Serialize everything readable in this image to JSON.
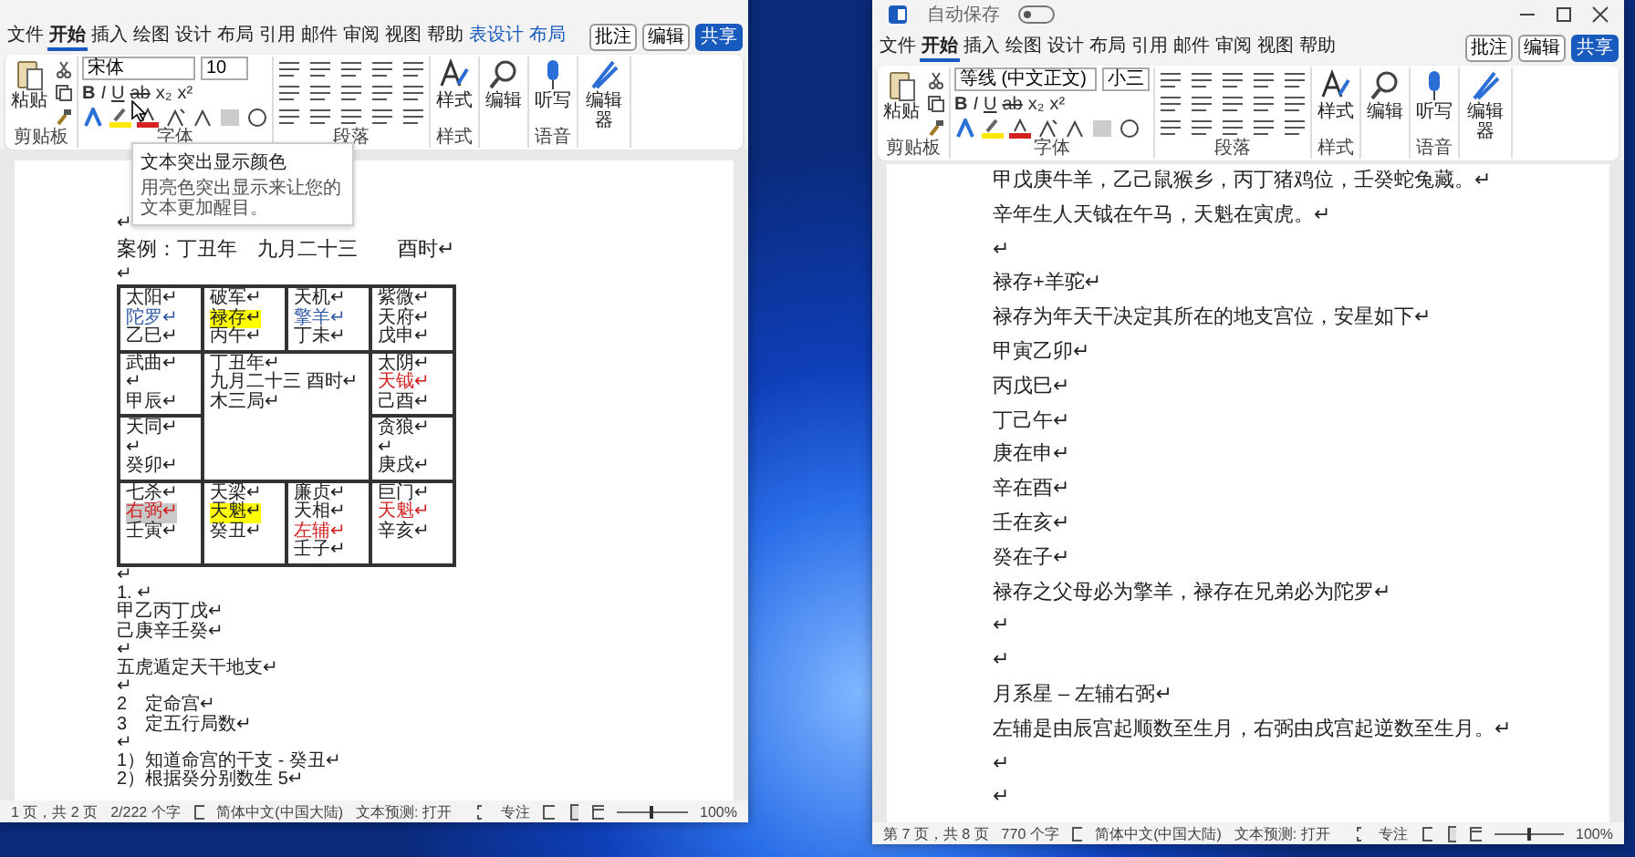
{
  "windows": [
    {
      "tabs": [
        {
          "label": "文件",
          "selected": false,
          "kind": "normal"
        },
        {
          "label": "开始",
          "selected": true,
          "kind": "normal"
        },
        {
          "label": "插入",
          "selected": false,
          "kind": "normal"
        },
        {
          "label": "绘图",
          "selected": false,
          "kind": "normal"
        },
        {
          "label": "设计",
          "selected": false,
          "kind": "normal"
        },
        {
          "label": "布局",
          "selected": false,
          "kind": "normal"
        },
        {
          "label": "引用",
          "selected": false,
          "kind": "normal"
        },
        {
          "label": "邮件",
          "selected": false,
          "kind": "normal"
        },
        {
          "label": "审阅",
          "selected": false,
          "kind": "normal"
        },
        {
          "label": "视图",
          "selected": false,
          "kind": "normal"
        },
        {
          "label": "帮助",
          "selected": false,
          "kind": "normal"
        },
        {
          "label": "表设计",
          "selected": false,
          "kind": "contextual"
        },
        {
          "label": "布局",
          "selected": false,
          "kind": "contextual"
        }
      ],
      "actions": [
        {
          "label": "批注",
          "kind": "outline"
        },
        {
          "label": "编辑",
          "kind": "outline"
        },
        {
          "label": "共享",
          "kind": "primary"
        }
      ],
      "sections": [
        {
          "kind": "clipboard",
          "label": "剪贴板",
          "button": "粘贴"
        },
        {
          "kind": "font",
          "label": "字体",
          "font_name": "宋体",
          "font_size": "10",
          "format_buttons": [
            "B",
            "I",
            "U",
            "ab",
            "x₂",
            "x²"
          ]
        },
        {
          "kind": "paragraph",
          "label": "段落"
        },
        {
          "kind": "styles",
          "label": "样式",
          "button": "样式"
        },
        {
          "kind": "editing",
          "button": "编辑"
        },
        {
          "kind": "dictate",
          "label": "语音",
          "button": "听写"
        },
        {
          "kind": "editor",
          "button": "编辑器"
        }
      ],
      "tooltip": {
        "title": "文本突出显示颜色",
        "body": "用亮色突出显示来让您的文本更加醒目。"
      },
      "doc": [
        {
          "kind": "para",
          "text": "↵"
        },
        {
          "kind": "title",
          "text": "案例：丁丑年　九月二十三　　酉时↵"
        },
        {
          "kind": "para",
          "text": "↵"
        },
        {
          "kind": "table",
          "cells": [
            {
              "kind": "palace",
              "lines": [
                {
                  "text": "太阳↵",
                  "color": "#222222"
                },
                {
                  "text": "陀罗↵",
                  "color": "#2f5aa8"
                },
                {
                  "text": "乙巳↵",
                  "color": "#222222"
                }
              ]
            },
            {
              "kind": "palace",
              "lines": [
                {
                  "text": "破军↵",
                  "color": "#222222"
                },
                {
                  "text": "禄存↵",
                  "highlight": {
                    "color": "#ffff00"
                  }
                },
                {
                  "text": "丙午↵",
                  "color": "#222222"
                }
              ]
            },
            {
              "kind": "palace",
              "lines": [
                {
                  "text": "天机↵",
                  "color": "#222222"
                },
                {
                  "text": "擎羊↵",
                  "color": "#2f5aa8"
                },
                {
                  "text": "丁未↵",
                  "color": "#222222"
                }
              ]
            },
            {
              "kind": "palace",
              "lines": [
                {
                  "text": "紫微↵",
                  "color": "#222222"
                },
                {
                  "text": "天府↵",
                  "color": "#222222"
                },
                {
                  "text": "戊申↵",
                  "color": "#222222"
                }
              ]
            },
            {
              "kind": "palace",
              "lines": [
                {
                  "text": "武曲↵",
                  "color": "#222222"
                },
                {
                  "text": "↵",
                  "color": "#222222"
                },
                {
                  "text": "甲辰↵",
                  "color": "#222222"
                }
              ]
            },
            {
              "kind": "center",
              "lines": [
                {
                  "text": "丁丑年↵",
                  "color": "#222222"
                },
                {
                  "text": "九月二十三 酉时↵",
                  "color": "#222222"
                },
                {
                  "text": "木三局↵",
                  "color": "#222222"
                }
              ]
            },
            {
              "kind": "palace",
              "lines": [
                {
                  "text": "太阴↵",
                  "color": "#222222"
                },
                {
                  "text": "天钺↵",
                  "color": "#d42020"
                },
                {
                  "text": "己酉↵",
                  "color": "#222222"
                }
              ]
            },
            {
              "kind": "palace",
              "lines": [
                {
                  "text": "天同↵",
                  "color": "#222222"
                },
                {
                  "text": "↵",
                  "color": "#222222"
                },
                {
                  "text": "癸卯↵",
                  "color": "#222222"
                }
              ]
            },
            {
              "kind": "palace",
              "lines": [
                {
                  "text": "贪狼↵",
                  "color": "#222222"
                },
                {
                  "text": "↵",
                  "color": "#222222"
                },
                {
                  "text": "庚戌↵",
                  "color": "#222222"
                }
              ]
            },
            {
              "kind": "palace",
              "lines": [
                {
                  "text": "七杀↵",
                  "color": "#222222"
                },
                {
                  "text": "右弼↵",
                  "color": "#d42020",
                  "highlight": {
                    "color": "#c8c8c8"
                  }
                },
                {
                  "text": "壬寅↵",
                  "color": "#222222"
                }
              ]
            },
            {
              "kind": "palace",
              "lines": [
                {
                  "text": "天梁↵",
                  "color": "#222222"
                },
                {
                  "text": "天魁↵",
                  "highlight": {
                    "color": "#ffff00"
                  }
                },
                {
                  "text": "癸丑↵",
                  "color": "#222222"
                }
              ]
            },
            {
              "kind": "palace",
              "lines": [
                {
                  "text": "廉贞↵",
                  "color": "#222222"
                },
                {
                  "text": "天相↵",
                  "color": "#222222"
                },
                {
                  "text": "左辅↵",
                  "color": "#d42020"
                },
                {
                  "text": "壬子↵",
                  "color": "#222222"
                }
              ]
            },
            {
              "kind": "palace",
              "lines": [
                {
                  "text": "巨门↵",
                  "color": "#222222"
                },
                {
                  "text": "天魁↵",
                  "color": "#d42020"
                },
                {
                  "text": "辛亥↵",
                  "color": "#222222"
                }
              ]
            }
          ]
        },
        {
          "kind": "para",
          "text": "↵"
        },
        {
          "kind": "para",
          "text": "1. ↵"
        },
        {
          "kind": "para",
          "text": "甲乙丙丁戊↵"
        },
        {
          "kind": "para",
          "text": "己庚辛壬癸↵"
        },
        {
          "kind": "para",
          "text": "↵"
        },
        {
          "kind": "para",
          "text": "五虎遁定天干地支↵"
        },
        {
          "kind": "para",
          "text": "↵"
        },
        {
          "kind": "para",
          "text": "2　定命宫↵"
        },
        {
          "kind": "para",
          "text": "3　定五行局数↵"
        },
        {
          "kind": "para",
          "text": "↵"
        },
        {
          "kind": "para",
          "text": "1）知道命宫的干支 - 癸丑↵"
        },
        {
          "kind": "para",
          "text": "2）根据癸分别数生 5↵"
        }
      ],
      "status": {
        "items": [
          "1 页，共 2 页",
          "2/222 个字",
          "简体中文(中国大陆)",
          "文本预测: 打开"
        ],
        "focus": "专注",
        "zoom_slider": {
          "level": 0.5
        },
        "zoom": "100%"
      }
    },
    {
      "title_bar": {
        "autosave": "自动保存",
        "autosave_on": false
      },
      "tabs": [
        {
          "label": "文件",
          "selected": false,
          "kind": "normal"
        },
        {
          "label": "开始",
          "selected": true,
          "kind": "normal"
        },
        {
          "label": "插入",
          "selected": false,
          "kind": "normal"
        },
        {
          "label": "绘图",
          "selected": false,
          "kind": "normal"
        },
        {
          "label": "设计",
          "selected": false,
          "kind": "normal"
        },
        {
          "label": "布局",
          "selected": false,
          "kind": "normal"
        },
        {
          "label": "引用",
          "selected": false,
          "kind": "normal"
        },
        {
          "label": "邮件",
          "selected": false,
          "kind": "normal"
        },
        {
          "label": "审阅",
          "selected": false,
          "kind": "normal"
        },
        {
          "label": "视图",
          "selected": false,
          "kind": "normal"
        },
        {
          "label": "帮助",
          "selected": false,
          "kind": "normal"
        }
      ],
      "actions": [
        {
          "label": "批注",
          "kind": "outline"
        },
        {
          "label": "编辑",
          "kind": "outline"
        },
        {
          "label": "共享",
          "kind": "primary"
        }
      ],
      "sections": [
        {
          "kind": "clipboard",
          "label": "剪贴板",
          "button": "粘贴"
        },
        {
          "kind": "font",
          "label": "字体",
          "font_name": "等线 (中文正文)",
          "font_size": "小三",
          "format_buttons": [
            "B",
            "I",
            "U",
            "ab",
            "x₂",
            "x²"
          ]
        },
        {
          "kind": "paragraph",
          "label": "段落"
        },
        {
          "kind": "styles",
          "label": "样式",
          "button": "样式"
        },
        {
          "kind": "editing",
          "button": "编辑"
        },
        {
          "kind": "dictate",
          "label": "语音",
          "button": "听写"
        },
        {
          "kind": "editor",
          "button": "编辑器"
        }
      ],
      "doc": [
        {
          "kind": "para",
          "text": "甲戊庚牛羊，乙己鼠猴乡，丙丁猪鸡位，壬癸蛇兔藏。↵"
        },
        {
          "kind": "para",
          "text": "辛年生人天钺在午马，天魁在寅虎。↵"
        },
        {
          "kind": "para",
          "text": "↵"
        },
        {
          "kind": "para",
          "text": "禄存+羊驼↵"
        },
        {
          "kind": "para",
          "text": "禄存为年天干决定其所在的地支宫位，安星如下↵"
        },
        {
          "kind": "para",
          "text": "甲寅乙卯↵"
        },
        {
          "kind": "para",
          "text": "丙戊巳↵"
        },
        {
          "kind": "para",
          "text": "丁己午↵"
        },
        {
          "kind": "para",
          "text": "庚在申↵"
        },
        {
          "kind": "para",
          "text": "辛在酉↵"
        },
        {
          "kind": "para",
          "text": "壬在亥↵"
        },
        {
          "kind": "para",
          "text": "癸在子↵"
        },
        {
          "kind": "para",
          "text": "禄存之父母必为擎羊，禄存在兄弟必为陀罗↵"
        },
        {
          "kind": "para",
          "text": "↵"
        },
        {
          "kind": "para",
          "text": "↵"
        },
        {
          "kind": "para",
          "text": "月系星 – 左辅右弼↵"
        },
        {
          "kind": "para",
          "text": "左辅是由辰宫起顺数至生月，右弼由戌宫起逆数至生月。↵"
        },
        {
          "kind": "para",
          "text": "↵"
        },
        {
          "kind": "para",
          "text": "↵"
        }
      ],
      "status": {
        "items": [
          "第 7 页，共 8 页",
          "770 个字",
          "简体中文(中国大陆)",
          "文本预测: 打开"
        ],
        "focus": "专注",
        "zoom_slider": {
          "level": 0.5
        },
        "zoom": "100%"
      }
    }
  ]
}
